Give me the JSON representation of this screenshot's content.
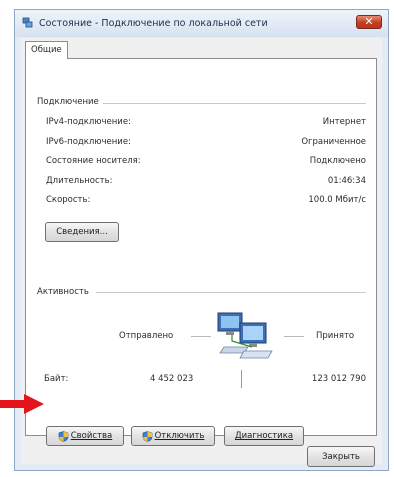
{
  "window": {
    "title": "Состояние - Подключение по локальной сети",
    "close_label": "✕"
  },
  "tabs": [
    {
      "label": "Общие"
    }
  ],
  "connection": {
    "group_title": "Подключение",
    "rows": [
      {
        "label": "IPv4-подключение:",
        "value": "Интернет"
      },
      {
        "label": "IPv6-подключение:",
        "value": "Ограниченное"
      },
      {
        "label": "Состояние носителя:",
        "value": "Подключено"
      },
      {
        "label": "Длительность:",
        "value": "01:46:34"
      },
      {
        "label": "Скорость:",
        "value": "100.0 Мбит/с"
      }
    ],
    "details_button": "Сведения..."
  },
  "activity": {
    "group_title": "Активность",
    "sent_label": "Отправлено",
    "received_label": "Принято",
    "bytes_label": "Байт:",
    "bytes_sent": "4 452 023",
    "bytes_received": "123 012 790"
  },
  "buttons": {
    "properties": "Свойства",
    "disable": "Отключить",
    "diagnose": "Диагностика",
    "close": "Закрыть"
  },
  "colors": {
    "arrow": "#e3141b",
    "close_button": "#c33f23",
    "title_bar": "#d6e2f1"
  }
}
